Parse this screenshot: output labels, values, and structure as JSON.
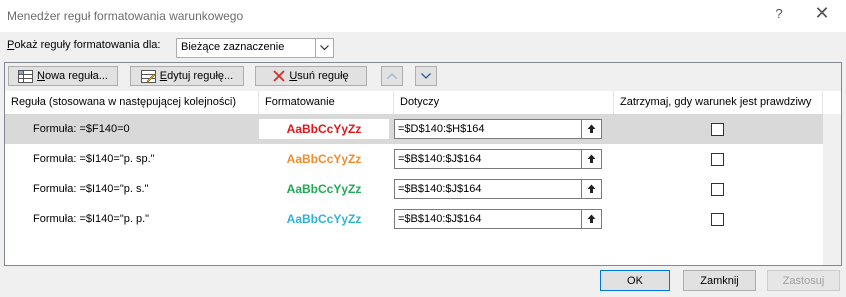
{
  "window": {
    "title": "Menedżer reguł formatowania warunkowego",
    "help_glyph": "?",
    "close_glyph": "✕"
  },
  "show_rules": {
    "label_accel": "P",
    "label_rest": "okaż reguły formatowania dla:",
    "selected": "Bieżące zaznaczenie"
  },
  "toolbar": {
    "new_rule_accel": "N",
    "new_rule_rest": "owa reguła...",
    "edit_rule_accel": "E",
    "edit_rule_rest": "dytuj regułę...",
    "delete_rule_accel": "U",
    "delete_rule_rest": "suń regułę",
    "up_icon": "arrow-up-icon",
    "down_icon": "arrow-down-icon"
  },
  "columns": {
    "rule": "Reguła (stosowana w następującej kolejności)",
    "format": "Formatowanie",
    "applies_to": "Dotyczy",
    "stop_if_true": "Zatrzymaj, gdy warunek jest prawdziwy"
  },
  "rules": [
    {
      "rule": "Formuła: =$F140=0",
      "preview": "AaBbCcYyZz",
      "color": "#e0161c",
      "applies_to": "=$D$140:$H$164",
      "stop": false
    },
    {
      "rule": "Formuła: =$I140=\"p. sp.\"",
      "preview": "AaBbCcYyZz",
      "color": "#f08c2e",
      "applies_to": "=$B$140:$J$164",
      "stop": false
    },
    {
      "rule": "Formuła: =$I140=\"p. s.\"",
      "preview": "AaBbCcYyZz",
      "color": "#1faa55",
      "applies_to": "=$B$140:$J$164",
      "stop": false
    },
    {
      "rule": "Formuła: =$I140=\"p. p.\"",
      "preview": "AaBbCcYyZz",
      "color": "#2fb3d0",
      "applies_to": "=$B$140:$J$164",
      "stop": false
    }
  ],
  "footer": {
    "ok": "OK",
    "close": "Zamknij",
    "apply": "Zastosuj"
  }
}
